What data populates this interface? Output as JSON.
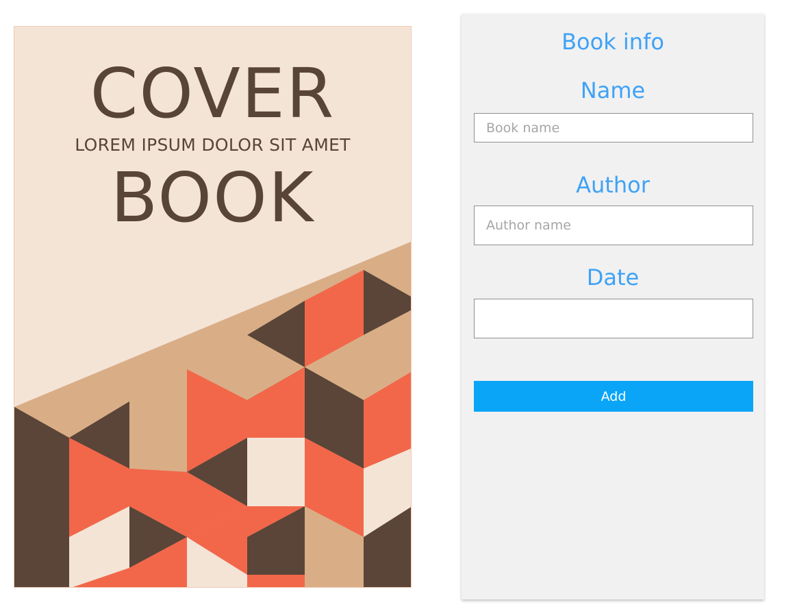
{
  "cover": {
    "title_top": "COVER",
    "subtitle": "LOREM IPSUM DOLOR SIT AMET",
    "title_bottom": "BOOK",
    "colors": {
      "background": "#f4e4d6",
      "dark": "#5a4538",
      "orange": "#f2674a",
      "tan": "#d9ae87",
      "cream": "#f4e4d6"
    }
  },
  "form": {
    "title": "Book info",
    "name_label": "Name",
    "name_placeholder": "Book name",
    "author_label": "Author",
    "author_placeholder": "Author name",
    "date_label": "Date",
    "date_value": "",
    "add_button": "Add",
    "accent_color": "#3ea2f6",
    "button_color": "#0aa5f7"
  }
}
